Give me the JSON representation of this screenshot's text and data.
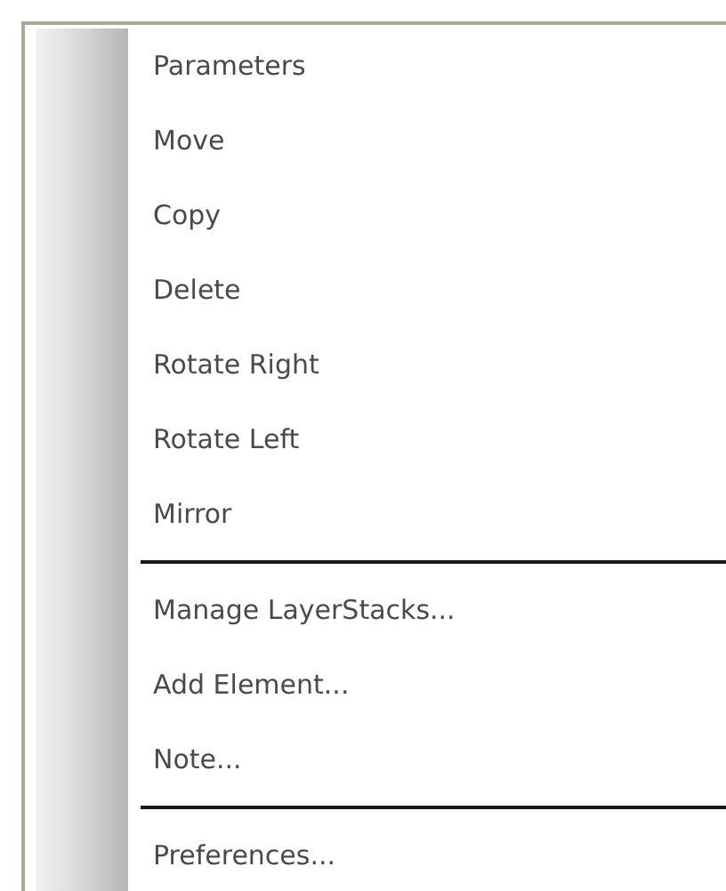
{
  "menu": {
    "groups": [
      {
        "items": [
          "Parameters",
          "Move",
          "Copy",
          "Delete",
          "Rotate Right",
          "Rotate Left",
          "Mirror"
        ]
      },
      {
        "items": [
          "Manage LayerStacks...",
          "Add Element...",
          "Note..."
        ]
      },
      {
        "items": [
          "Preferences..."
        ]
      }
    ]
  }
}
